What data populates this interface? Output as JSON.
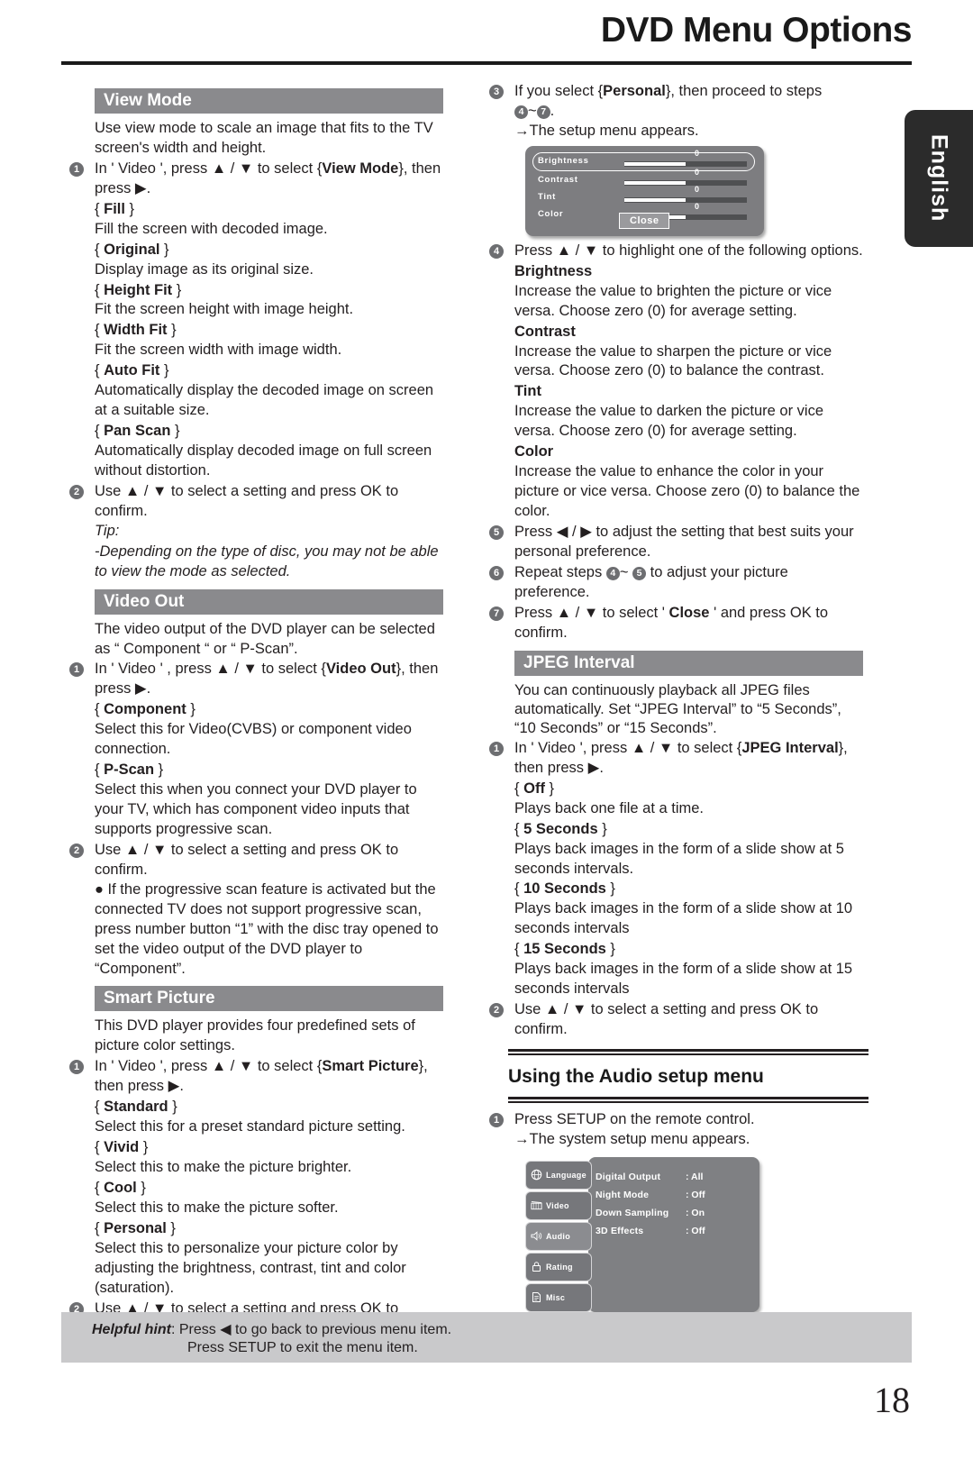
{
  "page": {
    "title": "DVD Menu Options",
    "language_tab": "English",
    "page_number": "18"
  },
  "left_column": {
    "view_mode": {
      "heading": "View Mode",
      "intro": "Use view mode to scale an image that fits to the TV screen's width and height.",
      "step1_pre": "In ' Video ', press ▲ / ▼ to select {",
      "step1_bold": "View Mode",
      "step1_post": "}, then press ▶.",
      "options": [
        {
          "name": "Fill",
          "desc": "Fill the screen with decoded image."
        },
        {
          "name": "Original",
          "desc": "Display image as its original size."
        },
        {
          "name": "Height Fit",
          "desc": "Fit the screen height with image height."
        },
        {
          "name": "Width Fit",
          "desc": "Fit the screen width with image width."
        },
        {
          "name": "Auto Fit",
          "desc": "Automatically display the decoded image on screen at a suitable size."
        },
        {
          "name": "Pan Scan",
          "desc": "Automatically display decoded image on full screen without distortion."
        }
      ],
      "step2": "Use ▲ / ▼ to select a setting and press OK to confirm.",
      "tip_label": "Tip:",
      "tip_text": "-Depending on the type of disc, you may not be able to view the mode as selected."
    },
    "video_out": {
      "heading": "Video Out",
      "intro": "The video output of the DVD player can be selected as “ Component “ or “ P-Scan”.",
      "step1_pre": "In  ' Video ' , press ▲ / ▼   to select  {",
      "step1_bold": "Video Out",
      "step1_post": "}, then press  ▶.",
      "options": [
        {
          "name": "Component",
          "desc": "Select this for Video(CVBS) or component video connection."
        },
        {
          "name": "P-Scan",
          "desc": "Select this when you connect your DVD player to your TV, which has component video inputs that supports progressive scan."
        }
      ],
      "step2": "Use ▲ / ▼ to select a setting and press OK to confirm.",
      "bullet_note": "● If the progressive scan feature is activated but the connected TV does not support progressive scan, press number button “1” with the disc tray opened to set the video output of the DVD player to “Component”."
    },
    "smart_picture": {
      "heading": "Smart Picture",
      "intro": "This DVD player provides four predefined sets of picture color settings.",
      "step1_pre": "In ' Video ', press ▲ / ▼ to select {",
      "step1_bold": "Smart Picture",
      "step1_post": "}, then press ▶.",
      "options": [
        {
          "name": "Standard",
          "desc": "Select this for a preset standard picture setting."
        },
        {
          "name": "Vivid",
          "desc": "Select this to make the picture brighter."
        },
        {
          "name": "Cool",
          "desc": "Select this to make the picture softer."
        },
        {
          "name": "Personal",
          "desc": "Select this to personalize your picture color by adjusting the brightness, contrast, tint and color (saturation)."
        }
      ],
      "step2": "Use ▲ / ▼ to select a setting and press OK to confirm."
    }
  },
  "right_column": {
    "personal_steps": {
      "step3_pre": "If you select {",
      "step3_bold": "Personal",
      "step3_post": "}, then proceed to steps",
      "step3_range_sep": "~",
      "step3_range_end": ".",
      "step3_result": "→The setup menu appears.",
      "osd_picture": {
        "rows": [
          {
            "label": "Brightness",
            "value": "0"
          },
          {
            "label": "Contrast",
            "value": "0"
          },
          {
            "label": "Tint",
            "value": "0"
          },
          {
            "label": "Color",
            "value": "0"
          }
        ],
        "close_button": "Close"
      },
      "step4": "Press ▲ / ▼ to highlight one of the following options.",
      "options": [
        {
          "name": "Brightness",
          "desc": "Increase the value to brighten the picture or vice versa. Choose zero (0) for average setting."
        },
        {
          "name": "Contrast",
          "desc": "Increase the value to sharpen the picture or vice versa.  Choose zero (0) to balance the contrast."
        },
        {
          "name": "Tint",
          "desc": "Increase the value to darken the picture or vice versa.  Choose zero (0) for average setting."
        },
        {
          "name": "Color",
          "desc": "Increase the value to enhance the color in your picture or vice versa. Choose zero (0) to balance the color."
        }
      ],
      "step5": "Press ◀ / ▶ to adjust the setting that best suits your personal preference.",
      "step6_pre": "Repeat steps",
      "step6_mid": "~",
      "step6_post": "to adjust your picture preference.",
      "step7_pre": "Press ▲ / ▼ to select  '",
      "step7_bold": "Close",
      "step7_post": "'  and press OK to confirm."
    },
    "jpeg_interval": {
      "heading": "JPEG Interval",
      "intro": "You can continuously playback all JPEG files automatically. Set “JPEG Interval” to “5 Seconds”, “10 Seconds” or “15 Seconds”.",
      "step1_pre": "In ' Video ', press ▲ / ▼ to select  {",
      "step1_bold": "JPEG Interval",
      "step1_post": "}, then press  ▶.",
      "options": [
        {
          "name": "Off",
          "desc": "Plays back one file at a time."
        },
        {
          "name": "5 Seconds",
          "desc": "Plays back images in the form of a slide show at 5 seconds intervals."
        },
        {
          "name": "10 Seconds",
          "desc": "Plays back images in the form of a slide show at 10 seconds intervals"
        },
        {
          "name": "15 Seconds",
          "desc": "Plays back images in the form of a slide show at 15 seconds intervals"
        }
      ],
      "step2": "Use ▲ / ▼ to select a setting and press OK to confirm."
    },
    "audio_setup": {
      "heading": "Using the Audio setup menu",
      "step1": "Press SETUP on the remote control.",
      "step1_result": "→The system setup menu appears.",
      "osd_system": {
        "tabs": [
          {
            "label": "Language",
            "icon": "globe-icon"
          },
          {
            "label": "Video",
            "icon": "film-icon"
          },
          {
            "label": "Audio",
            "icon": "speaker-icon"
          },
          {
            "label": "Rating",
            "icon": "lock-icon"
          },
          {
            "label": "Misc",
            "icon": "document-icon"
          }
        ],
        "items": [
          {
            "label": "Digital Output",
            "value": ": All"
          },
          {
            "label": "Night  Mode",
            "value": ": Off"
          },
          {
            "label": "Down Sampling",
            "value": ": On"
          },
          {
            "label": "3D Effects",
            "value": ": Off"
          }
        ]
      }
    }
  },
  "helpful_hint": {
    "label": "Helpful hint",
    "line1": ":  Press ◀ to go back to previous menu item.",
    "line2": "Press SETUP to exit the menu item."
  },
  "colors": {
    "section_bar": "#8a8a8d",
    "hint_bg": "#c9c9cb",
    "osd_bg": "#7d7d80",
    "lang_tab": "#2b2b2b"
  }
}
